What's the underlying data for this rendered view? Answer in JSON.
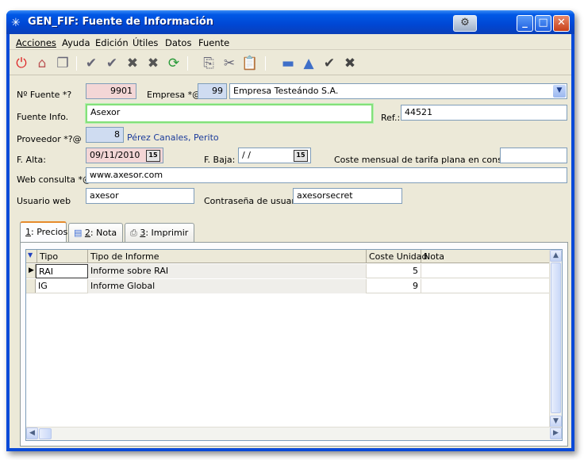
{
  "window": {
    "title": "GEN_FIF: Fuente de Información",
    "title_icon": "atom-icon"
  },
  "menu": [
    "Acciones",
    "Ayuda",
    "Edición",
    "Útiles",
    "Datos",
    "Fuente"
  ],
  "toolbar": {
    "icons": [
      "power-icon",
      "home-icon",
      "windows-icon",
      "check-doc-icon",
      "check-doc-icon",
      "delete-doc-icon",
      "delete-doc-icon",
      "refresh-icon",
      "copy-icon",
      "cut-icon",
      "paste-icon",
      "minus-icon",
      "up-icon",
      "checkmark-icon",
      "x-icon"
    ]
  },
  "form": {
    "fuente_label": "Nº Fuente *?",
    "fuente_value": "9901",
    "empresa_label": "Empresa *@",
    "empresa_code": "99",
    "empresa_name": "Empresa Testeándo S.A.",
    "info_label": "Fuente Info.",
    "info_value": "Asexor",
    "ref_label": "Ref.:",
    "ref_value": "44521",
    "proveedor_label": "Proveedor *?@",
    "proveedor_code": "8",
    "proveedor_name": "Pérez Canales, Perito",
    "alta_label": "F. Alta:",
    "alta_value": "09/11/2010",
    "baja_label": "F. Baja:",
    "baja_value": " /  /",
    "coste_label": "Coste mensual de tarifa plana en consultas",
    "coste_value": "",
    "web_label": "Web consulta *@",
    "web_value": "www.axesor.com",
    "usuario_label": "Usuario web",
    "usuario_value": "axesor",
    "password_label": "Contraseña de usuario",
    "password_value": "axesorsecret",
    "calendar_label": "15"
  },
  "tabs": [
    {
      "key": "1",
      "label": ": Precios"
    },
    {
      "key": "2",
      "label": ": Nota"
    },
    {
      "key": "3",
      "label": ": Imprimir"
    }
  ],
  "grid": {
    "headers": [
      "Tipo",
      "Tipo de Informe",
      "Coste Unidad",
      "Nota"
    ],
    "rows": [
      {
        "tipo": "RAI",
        "informe": "Informe sobre RAI",
        "coste": "5",
        "nota": ""
      },
      {
        "tipo": "IG",
        "informe": "Informe Global",
        "coste": "9",
        "nota": ""
      }
    ]
  }
}
